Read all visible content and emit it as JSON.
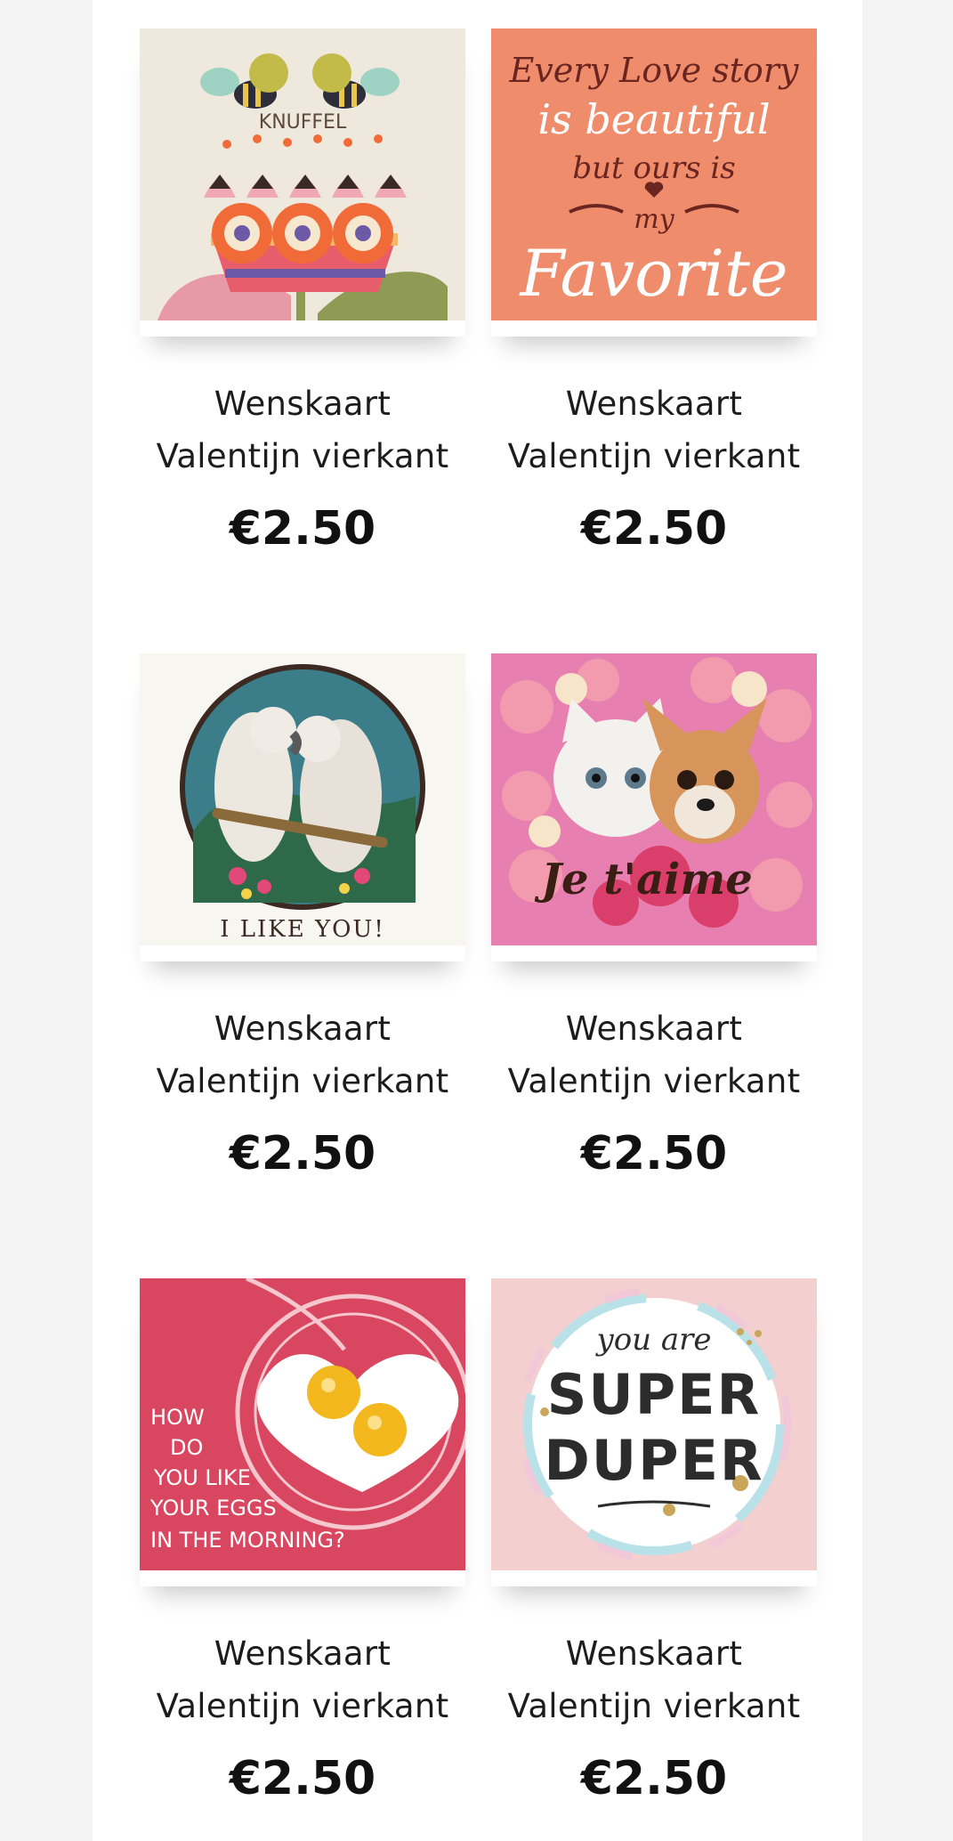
{
  "products": [
    {
      "title_line1": "Wenskaart",
      "title_line2": "Valentijn vierkant",
      "price": "€2.50",
      "image_icon": "bees-flower-card-image",
      "image_text": "KNUFFEL"
    },
    {
      "title_line1": "Wenskaart",
      "title_line2": "Valentijn vierkant",
      "price": "€2.50",
      "image_icon": "love-story-card-image",
      "image_text": "Every Love story is beautiful but ours is my Favorite"
    },
    {
      "title_line1": "Wenskaart",
      "title_line2": "Valentijn vierkant",
      "price": "€2.50",
      "image_icon": "parrots-card-image",
      "image_text": "I LIKE YOU!"
    },
    {
      "title_line1": "Wenskaart",
      "title_line2": "Valentijn vierkant",
      "price": "€2.50",
      "image_icon": "cat-dog-card-image",
      "image_text": "Je t'aime"
    },
    {
      "title_line1": "Wenskaart",
      "title_line2": "Valentijn vierkant",
      "price": "€2.50",
      "image_icon": "eggs-card-image",
      "image_text": "HOW DO YOU LIKE YOUR EGGS IN THE MORNING?"
    },
    {
      "title_line1": "Wenskaart",
      "title_line2": "Valentijn vierkant",
      "price": "€2.50",
      "image_icon": "super-duper-card-image",
      "image_text": "you are SUPER DUPER"
    }
  ]
}
